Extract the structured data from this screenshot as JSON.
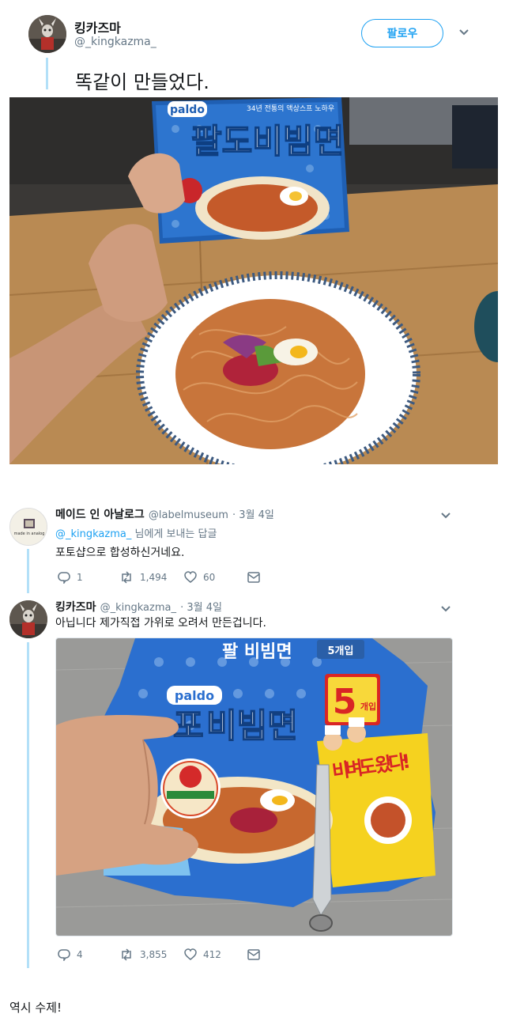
{
  "main_tweet": {
    "display_name": "킹카즈마",
    "handle": "@_kingkazma_",
    "follow_label": "팔로우",
    "text": "똑같이 만들었다.",
    "photo": {
      "package_brand": "paldo",
      "package_title": "팔도비빔면",
      "package_tag": "34년 전통의 액상스프 노하우"
    }
  },
  "replies": [
    {
      "display_name": "메이드 인 아날로그",
      "handle": "@labelmuseum",
      "date": "· 3월 4일",
      "reply_to_mention": "@_kingkazma_",
      "reply_to_suffix": " 님에게 보내는 답글",
      "text": "포토샵으로 합성하신거네요.",
      "avatar_text": "made in analog",
      "stats": {
        "replies": "1",
        "retweets": "1,494",
        "likes": "60"
      }
    },
    {
      "display_name": "킹카즈마",
      "handle": "@_kingkazma_",
      "date": "· 3월 4일",
      "text": "아닙니다 제가직접 가위로 오려서 만든겁니다.",
      "photo": {
        "package_brand": "paldo",
        "package_title": "비빔면",
        "badge": "5개입",
        "side_text": "비벼도 왔다!"
      },
      "stats": {
        "replies": "4",
        "retweets": "3,855",
        "likes": "412"
      }
    }
  ],
  "footer": {
    "text": "역시 수제!"
  },
  "colors": {
    "accent": "#1da1f2",
    "muted": "#657786",
    "thread": "#b3e0f8"
  },
  "icons": [
    "chevron-down-icon",
    "reply-icon",
    "retweet-icon",
    "like-icon",
    "dm-icon"
  ]
}
